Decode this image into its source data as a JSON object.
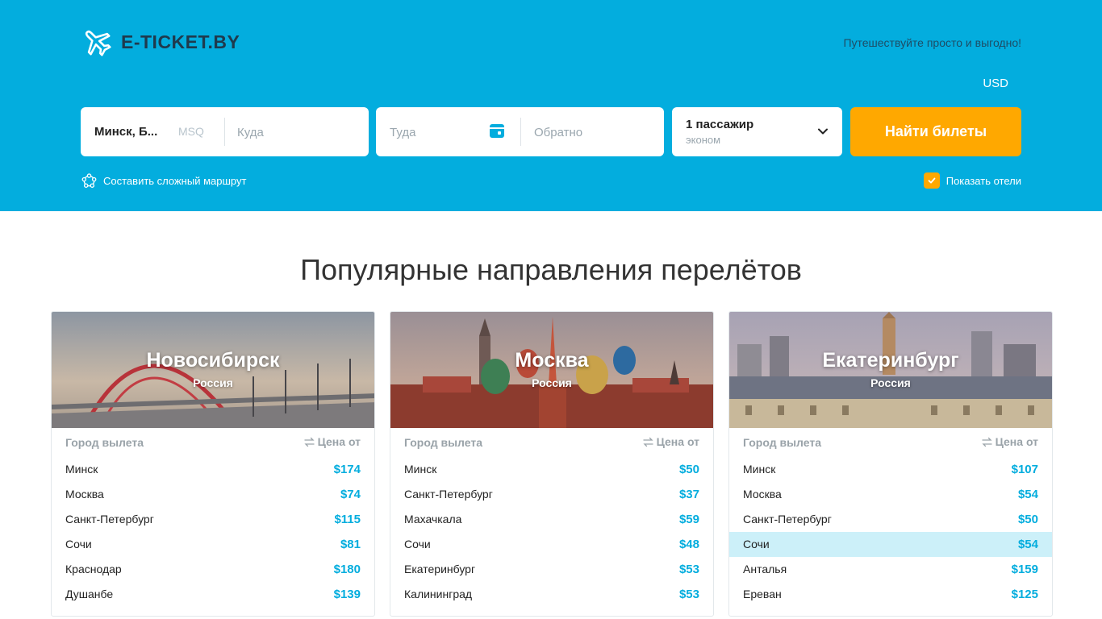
{
  "header": {
    "logo_text": "E-TICKET.BY",
    "tagline": "Путешествуйте просто и выгодно!",
    "currency": "USD",
    "logo_icon": "airplane-icon"
  },
  "search": {
    "from_value": "Минск, Б...",
    "from_code": "MSQ",
    "to_placeholder": "Куда",
    "depart_placeholder": "Туда",
    "return_placeholder": "Обратно",
    "passengers": "1 пассажир",
    "cabin_class": "эконом",
    "search_button": "Найти билеты",
    "complex_route": "Составить сложный маршрут",
    "show_hotels": "Показать отели",
    "show_hotels_checked": true
  },
  "section": {
    "title": "Популярные направления перелётов"
  },
  "colors": {
    "header_bg": "#03ADDE",
    "accent": "#FFA800",
    "price": "#03ADDE",
    "highlight_row": "#CCF0F9"
  },
  "cards": [
    {
      "city": "Новосибирск",
      "country": "Россия",
      "col_from": "Город вылета",
      "col_price": "Цена от",
      "rows": [
        {
          "city": "Минск",
          "price": "$174"
        },
        {
          "city": "Москва",
          "price": "$74"
        },
        {
          "city": "Санкт-Петербург",
          "price": "$115"
        },
        {
          "city": "Сочи",
          "price": "$81"
        },
        {
          "city": "Краснодар",
          "price": "$180"
        },
        {
          "city": "Душанбе",
          "price": "$139"
        }
      ]
    },
    {
      "city": "Москва",
      "country": "Россия",
      "col_from": "Город вылета",
      "col_price": "Цена от",
      "rows": [
        {
          "city": "Минск",
          "price": "$50"
        },
        {
          "city": "Санкт-Петербург",
          "price": "$37"
        },
        {
          "city": "Махачкала",
          "price": "$59"
        },
        {
          "city": "Сочи",
          "price": "$48"
        },
        {
          "city": "Екатеринбург",
          "price": "$53"
        },
        {
          "city": "Калининград",
          "price": "$53"
        }
      ]
    },
    {
      "city": "Екатеринбург",
      "country": "Россия",
      "col_from": "Город вылета",
      "col_price": "Цена от",
      "rows": [
        {
          "city": "Минск",
          "price": "$107"
        },
        {
          "city": "Москва",
          "price": "$54"
        },
        {
          "city": "Санкт-Петербург",
          "price": "$50"
        },
        {
          "city": "Сочи",
          "price": "$54"
        },
        {
          "city": "Анталья",
          "price": "$159"
        },
        {
          "city": "Ереван",
          "price": "$125"
        }
      ]
    }
  ]
}
